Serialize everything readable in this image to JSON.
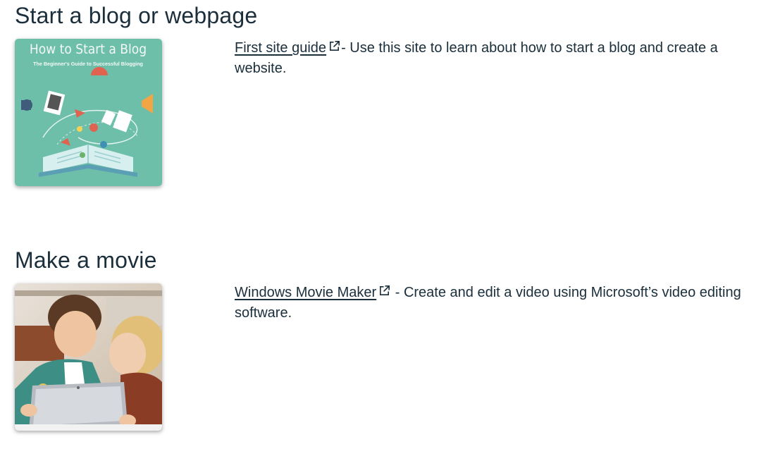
{
  "sections": [
    {
      "title": "Start a blog or webpage",
      "image": {
        "kind": "book-cover",
        "cover_title": "How to Start a Blog",
        "cover_subtitle": "The Beginner's Guide to Successful Blogging",
        "background": "#6dbfa9"
      },
      "link_text": "First site guide",
      "description": "- Use this site to learn about how to start a blog and create a website."
    },
    {
      "title": "Make a movie",
      "image": {
        "kind": "photo",
        "subject": "boy and woman looking at a tablet"
      },
      "link_text": "Windows Movie Maker",
      "description": " - Create and edit a video using Microsoft’s video editing software."
    }
  ],
  "icons": {
    "external_link": "external-link-icon"
  },
  "colors": {
    "text": "#1a2e3b",
    "cover_teal": "#6dbfa9"
  }
}
